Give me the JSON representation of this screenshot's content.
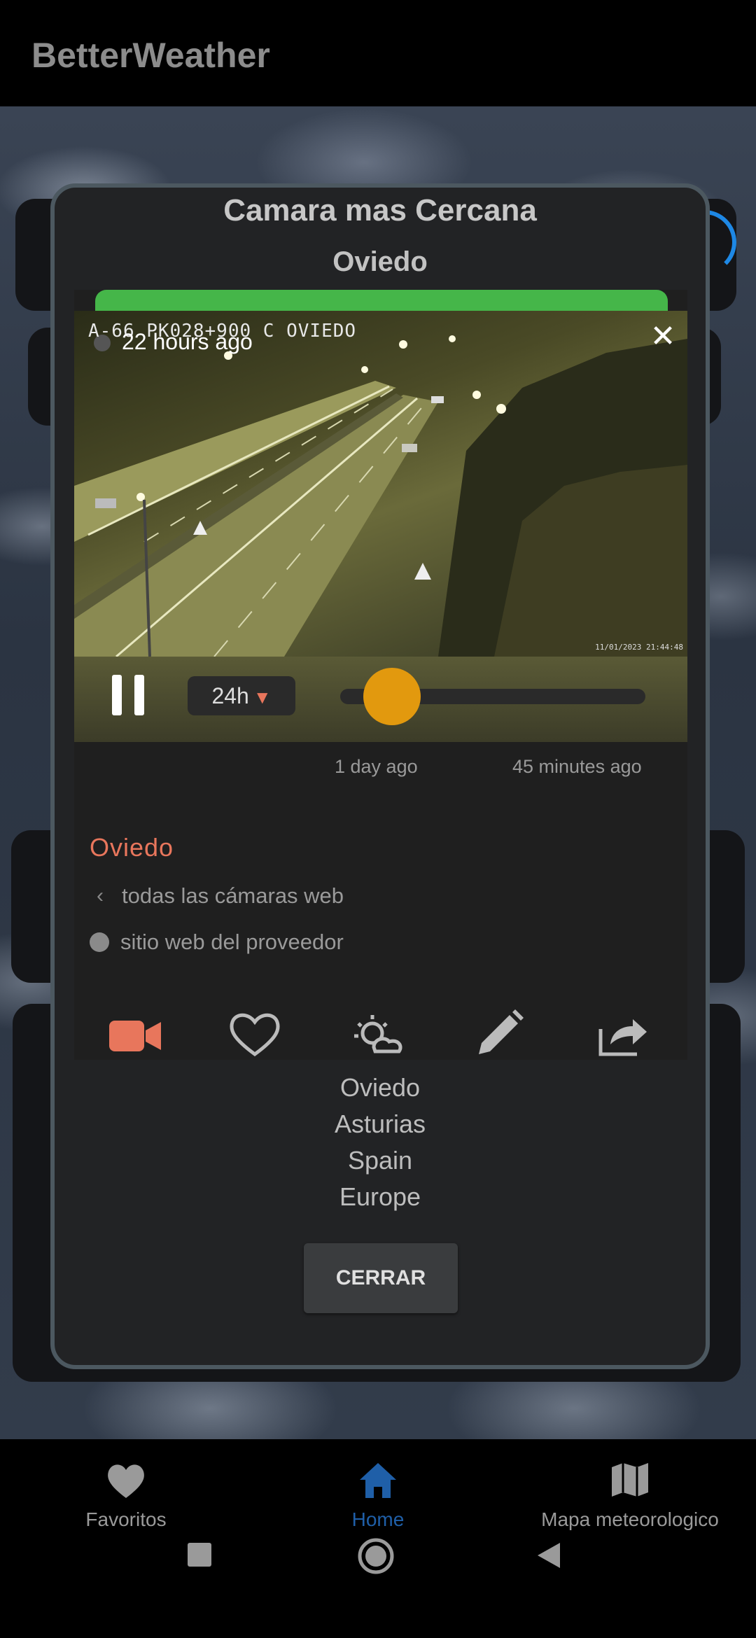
{
  "app": {
    "title": "BetterWeather"
  },
  "dialog": {
    "title": "Camara mas Cercana",
    "subtitle": "Oviedo",
    "camera": {
      "overlay_label": "A-66 PK028+900 C OVIEDO",
      "time_ago": "22 hours ago",
      "timestamp": "11/01/2023 21:44:48",
      "range": "24h",
      "timeline_start": "1 day ago",
      "timeline_end": "45 minutes ago",
      "slider_position": 0.17
    },
    "location_title": "Oviedo",
    "links": {
      "all_webcams": "todas las cámaras web",
      "provider_site": "sitio web del proveedor"
    },
    "icons": [
      "video-camera-icon",
      "heart-icon",
      "weather-icon",
      "pencil-icon",
      "share-icon"
    ],
    "location_lines": [
      "Oviedo",
      "Asturias",
      "Spain",
      "Europe"
    ],
    "close_button": "CERRAR"
  },
  "nav": {
    "items": [
      {
        "label": "Favoritos",
        "icon": "heart-icon"
      },
      {
        "label": "Home",
        "icon": "home-icon",
        "active": true
      },
      {
        "label": "Mapa meteorologico",
        "icon": "map-icon"
      }
    ]
  },
  "colors": {
    "accent": "#e8765c",
    "slider_knob": "#e2990e",
    "nav_active": "#1f5fa8",
    "green_bar": "#45b649"
  }
}
